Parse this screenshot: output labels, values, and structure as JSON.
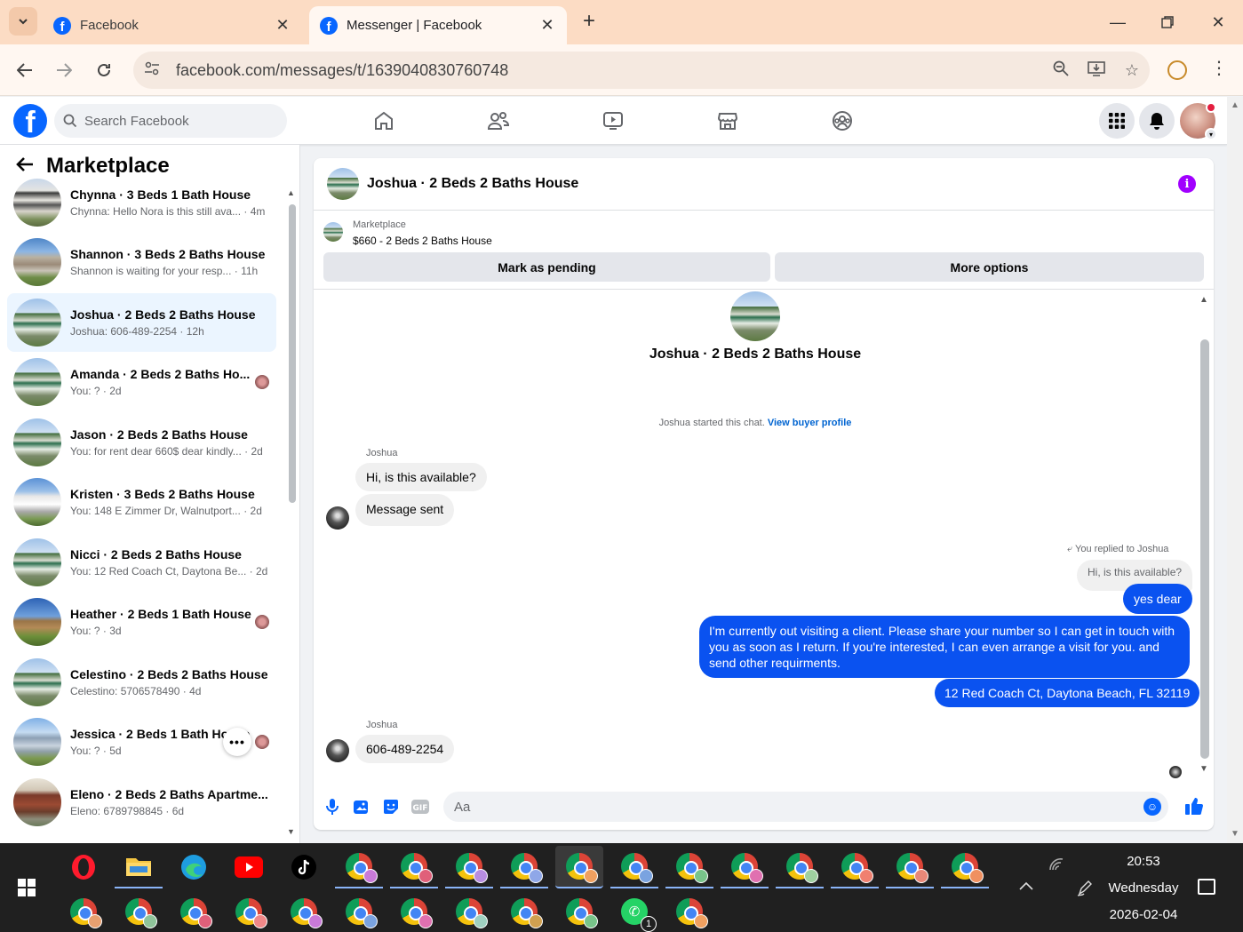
{
  "browser": {
    "tabs": [
      {
        "title": "Facebook",
        "active": false
      },
      {
        "title": "Messenger | Facebook",
        "active": true
      }
    ],
    "new_tab": "+",
    "url": "facebook.com/messages/t/1639040830760748"
  },
  "facebook": {
    "search_placeholder": "Search Facebook",
    "nav_icons": [
      "home-icon",
      "friends-icon",
      "video-icon",
      "marketplace-icon",
      "groups-icon"
    ]
  },
  "sidebar": {
    "title": "Marketplace",
    "conversations": [
      {
        "name": "Chynna · 3 Beds 1 Bath House",
        "snippet": "Chynna: Hello Nora is this still ava... · 4m",
        "thumb": "victorian"
      },
      {
        "name": "Shannon · 3 Beds 2 Baths House",
        "snippet": "Shannon is waiting for your resp... · 11h",
        "thumb": "ranch"
      },
      {
        "name": "Joshua · 2 Beds 2 Baths House",
        "snippet": "Joshua: 606-489-2254 · 12h",
        "thumb": "mobile",
        "active": true
      },
      {
        "name": "Amanda · 2 Beds 2 Baths Ho...",
        "snippet": "You: ? · 2d",
        "thumb": "mobile",
        "seen": true
      },
      {
        "name": "Jason · 2 Beds 2 Baths House",
        "snippet": "You: for rent dear 660$ dear kindly... · 2d",
        "thumb": "mobile"
      },
      {
        "name": "Kristen · 3 Beds 2 Baths House",
        "snippet": "You: 148 E Zimmer Dr, Walnutport... · 2d",
        "thumb": "white"
      },
      {
        "name": "Nicci · 2 Beds 2 Baths House",
        "snippet": "You: 12 Red Coach Ct, Daytona Be... · 2d",
        "thumb": "mobile"
      },
      {
        "name": "Heather · 2 Beds 1 Bath House",
        "snippet": "You: ? · 3d",
        "thumb": "cabin",
        "seen": true
      },
      {
        "name": "Celestino · 2 Beds 2 Baths House",
        "snippet": "Celestino: 5706578490 · 4d",
        "thumb": "mobile"
      },
      {
        "name": "Jessica · 2 Beds 1 Bath House",
        "snippet": "You: ? · 5d",
        "thumb": "blue",
        "seen": true,
        "more": "•••"
      },
      {
        "name": "Eleno · 2 Beds 2 Baths Apartme...",
        "snippet": "Eleno: 6789798845 · 6d",
        "thumb": "brick"
      }
    ]
  },
  "chat": {
    "header_title": "Joshua · 2 Beds 2 Baths House",
    "marketplace_label": "Marketplace",
    "listing": "$660 - 2 Beds 2 Baths House",
    "mark_pending": "Mark as pending",
    "more_options": "More options",
    "intro_title": "Joshua · 2 Beds 2 Baths House",
    "started_text": "Joshua started this chat.",
    "view_profile": "View buyer profile",
    "sender_name": "Joshua",
    "incoming_1": "Hi, is this available?",
    "incoming_2": "Message sent",
    "replied_label": "You replied to Joshua",
    "quoted": "Hi, is this available?",
    "outgoing_1": "yes dear",
    "outgoing_2": "I'm currently out visiting a client. Please share your number so I can get in touch with you as soon as I return. If you're interested, I can even arrange a visit for you. and send other requirments.",
    "outgoing_3": "12 Red Coach Ct, Daytona Beach, FL 32119",
    "sender_name_2": "Joshua",
    "incoming_3": "606-489-2254",
    "composer_placeholder": "Aa"
  },
  "taskbar": {
    "time": "20:53",
    "day": "Wednesday",
    "date": "2026-02-04",
    "whatsapp_badge": "1"
  },
  "colors": {
    "facebook_blue": "#0866ff",
    "outgoing_bubble": "#0a52f0",
    "active_conversation": "#ebf5ff",
    "tab_bar": "#fcdcc4"
  }
}
